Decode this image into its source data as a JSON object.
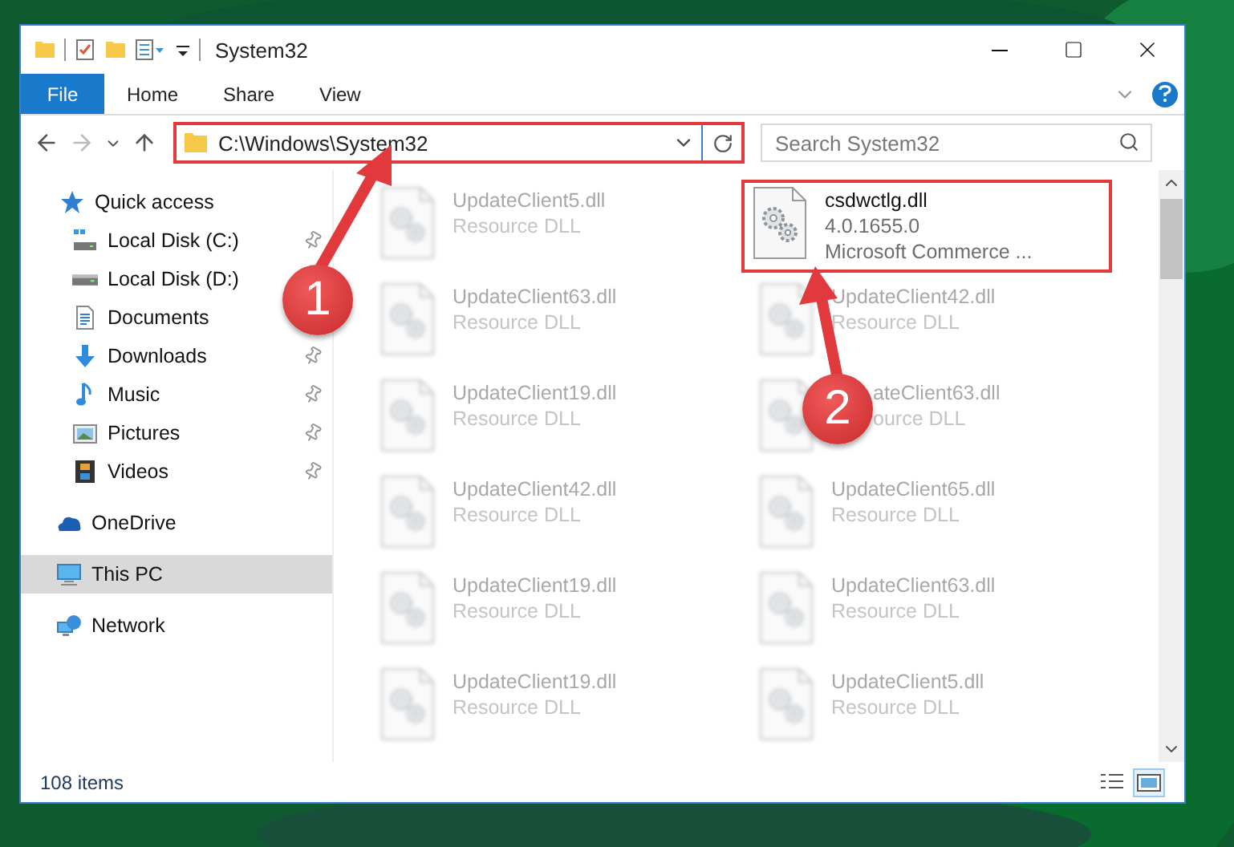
{
  "window": {
    "title": "System32"
  },
  "ribbon": {
    "tabs": [
      {
        "label": "File",
        "kind": "menu"
      },
      {
        "label": "Home",
        "kind": "tab"
      },
      {
        "label": "Share",
        "kind": "tab"
      },
      {
        "label": "View",
        "kind": "tab"
      }
    ]
  },
  "address": {
    "path": "C:\\Windows\\System32",
    "highlighted": true
  },
  "search": {
    "placeholder": "Search System32"
  },
  "nav": [
    {
      "label": "Quick access",
      "kind": "star",
      "selected": false,
      "children": [
        {
          "label": "Local Disk (C:)",
          "kind": "windrive",
          "pinned": true,
          "selected": false
        },
        {
          "label": "Local Disk (D:)",
          "kind": "drive",
          "selected": false
        },
        {
          "label": "Documents",
          "kind": "document",
          "selected": false
        },
        {
          "label": "Downloads",
          "kind": "download",
          "pinned": true,
          "selected": false
        },
        {
          "label": "Music",
          "kind": "music",
          "pinned": true,
          "selected": false
        },
        {
          "label": "Pictures",
          "kind": "picture",
          "pinned": true,
          "selected": false
        },
        {
          "label": "Videos",
          "kind": "video",
          "pinned": true,
          "selected": false
        }
      ]
    },
    {
      "label": "OneDrive",
      "kind": "cloud",
      "selected": false
    },
    {
      "label": "This PC",
      "kind": "computer",
      "selected": true
    },
    {
      "label": "Network",
      "kind": "network",
      "selected": false
    }
  ],
  "files": [
    {
      "name": "UpdateClient5.dll",
      "lines": [
        "Resource DLL"
      ],
      "faded": true,
      "highlighted": false
    },
    {
      "name": "csdwctlg.dll",
      "lines": [
        "4.0.1655.0",
        "Microsoft Commerce ..."
      ],
      "faded": false,
      "highlighted": true
    },
    {
      "name": "UpdateClient63.dll",
      "lines": [
        "Resource DLL"
      ],
      "faded": true,
      "highlighted": false
    },
    {
      "name": "UpdateClient42.dll",
      "lines": [
        "Resource DLL"
      ],
      "faded": true,
      "highlighted": false
    },
    {
      "name": "UpdateClient19.dll",
      "lines": [
        "Resource DLL"
      ],
      "faded": true,
      "highlighted": false
    },
    {
      "name": "ateClient63.dll",
      "lines": [
        "ource DLL"
      ],
      "faded": true,
      "highlighted": false,
      "covered": true
    },
    {
      "name": "UpdateClient42.dll",
      "lines": [
        "Resource DLL"
      ],
      "faded": true,
      "highlighted": false
    },
    {
      "name": "UpdateClient65.dll",
      "lines": [
        "Resource DLL"
      ],
      "faded": true,
      "highlighted": false
    },
    {
      "name": "UpdateClient19.dll",
      "lines": [
        "Resource DLL"
      ],
      "faded": true,
      "highlighted": false
    },
    {
      "name": "UpdateClient63.dll",
      "lines": [
        "Resource DLL"
      ],
      "faded": true,
      "highlighted": false
    },
    {
      "name": "UpdateClient19.dll",
      "lines": [
        "Resource DLL"
      ],
      "faded": true,
      "highlighted": false
    },
    {
      "name": "UpdateClient5.dll",
      "lines": [
        "Resource DLL"
      ],
      "faded": true,
      "highlighted": false
    }
  ],
  "status_bar": {
    "count": "108 items",
    "views": [
      {
        "kind": "details",
        "selected": false
      },
      {
        "kind": "tiles",
        "selected": true
      }
    ]
  },
  "annotations": [
    {
      "label": "1"
    },
    {
      "label": "2"
    }
  ]
}
